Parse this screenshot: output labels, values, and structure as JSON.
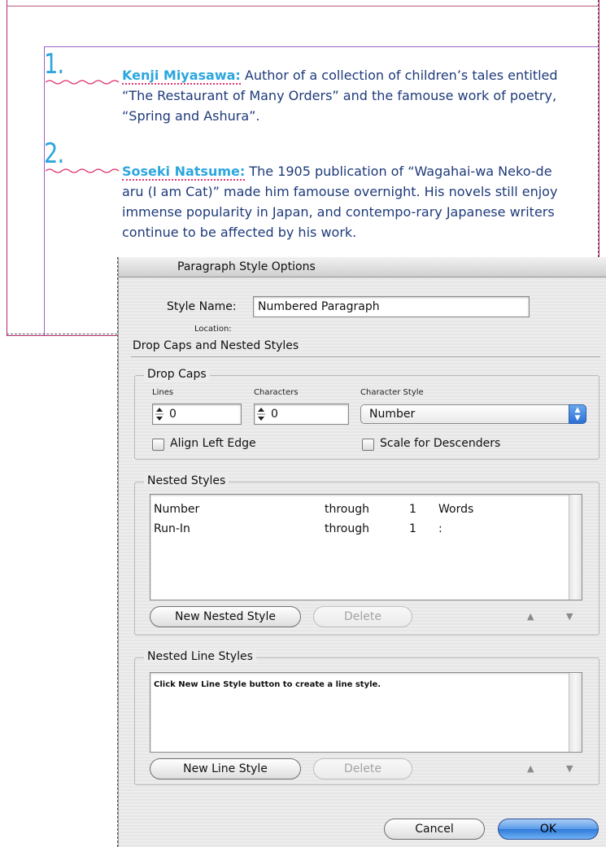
{
  "document": {
    "items": [
      {
        "number": "1.",
        "name": "Kenji Miyasawa:",
        "text": " Author of a collection of children’s tales entitled “The Restaurant of Many Orders” and the famouse work of poetry, “Spring and Ashura”."
      },
      {
        "number": "2.",
        "name": "Soseki Natsume:",
        "text": " The 1905 publication of “Wagahai-wa Neko-de aru (I am Cat)” made him famouse overnight. His novels still enjoy immense popularity in Japan, and contempo-rary Japanese writers continue to be affected by his work."
      }
    ]
  },
  "dialog": {
    "title": "Paragraph Style Options",
    "style_name_label": "Style Name:",
    "style_name_value": "Numbered Paragraph",
    "location_label": "Location:",
    "section_title": "Drop Caps and Nested Styles",
    "drop_caps": {
      "title": "Drop Caps",
      "lines_label": "Lines",
      "lines_value": "0",
      "characters_label": "Characters",
      "characters_value": "0",
      "char_style_label": "Character Style",
      "char_style_value": "Number",
      "align_left_edge": "Align Left Edge",
      "scale_for_descenders": "Scale for Descenders"
    },
    "nested_styles": {
      "title": "Nested Styles",
      "rows": [
        {
          "style": "Number",
          "mode": "through",
          "count": "1",
          "unit": "Words"
        },
        {
          "style": "Run-In",
          "mode": "through",
          "count": "1",
          "unit": ":"
        }
      ],
      "new_button": "New Nested Style",
      "delete_button": "Delete"
    },
    "nested_line_styles": {
      "title": "Nested Line Styles",
      "hint": "Click New Line Style button to create a line style.",
      "new_button": "New Line Style",
      "delete_button": "Delete"
    },
    "cancel_button": "Cancel",
    "ok_button": "OK"
  },
  "colors": {
    "run_in": "#2ca6de",
    "body_text": "#1e3a7a",
    "frame_edge": "#b5266d",
    "margin_guide": "#9b63c9",
    "ok_button": "#3b86df"
  },
  "icons": [
    "stepper-icon",
    "popup-arrows-icon",
    "move-up-icon",
    "move-down-icon",
    "checkbox-icon"
  ]
}
